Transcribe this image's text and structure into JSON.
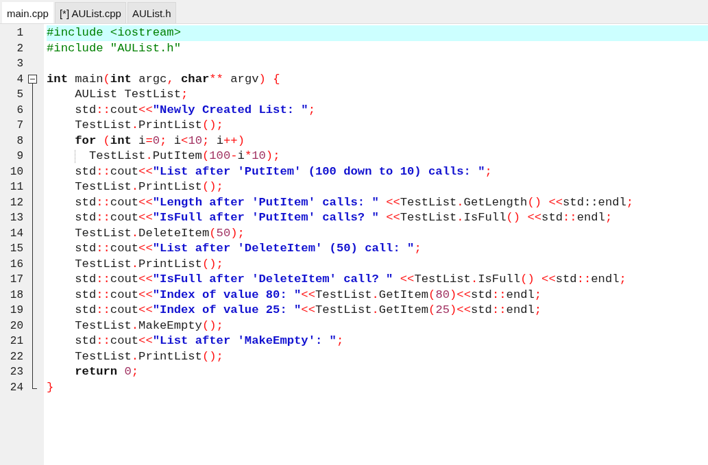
{
  "tabs": [
    {
      "label": "main.cpp",
      "selected": true
    },
    {
      "label": "[*] AUList.cpp",
      "selected": false
    },
    {
      "label": "AUList.h",
      "selected": false
    }
  ],
  "editor": {
    "lines": [
      {
        "number": "1",
        "current": true,
        "tokens": [
          {
            "kind": "pp",
            "text": "#include <iostream>"
          }
        ]
      },
      {
        "number": "2",
        "current": false,
        "tokens": [
          {
            "kind": "pp",
            "text": "#include \"AUList.h\""
          }
        ]
      },
      {
        "number": "3",
        "current": false
      },
      {
        "number": "4",
        "current": false,
        "fold": {
          "kind": "start"
        },
        "tokens": [
          {
            "kind": "kw",
            "text": "int"
          },
          {
            "kind": "plain",
            "text": " main"
          },
          {
            "kind": "op",
            "text": "("
          },
          {
            "kind": "kw",
            "text": "int"
          },
          {
            "kind": "plain",
            "text": " argc"
          },
          {
            "kind": "op",
            "text": ","
          },
          {
            "kind": "kw",
            "text": " char"
          },
          {
            "kind": "op",
            "text": "**"
          },
          {
            "kind": "plain",
            "text": " argv"
          },
          {
            "kind": "op",
            "text": ") {"
          }
        ]
      },
      {
        "number": "5",
        "current": false,
        "fold": {
          "kind": "line"
        },
        "tokens": [
          {
            "kind": "plain",
            "text": "    AUList TestList"
          },
          {
            "kind": "op",
            "text": ";"
          }
        ]
      },
      {
        "number": "6",
        "current": false,
        "fold": {
          "kind": "line"
        },
        "tokens": [
          {
            "kind": "plain",
            "text": "    std"
          },
          {
            "kind": "op",
            "text": "::"
          },
          {
            "kind": "plain",
            "text": "cout"
          },
          {
            "kind": "op",
            "text": "<<"
          },
          {
            "kind": "str",
            "text": "\"Newly Created List: \""
          },
          {
            "kind": "op",
            "text": ";"
          }
        ]
      },
      {
        "number": "7",
        "current": false,
        "fold": {
          "kind": "line"
        },
        "tokens": [
          {
            "kind": "plain",
            "text": "    TestList"
          },
          {
            "kind": "op",
            "text": "."
          },
          {
            "kind": "plain",
            "text": "PrintList"
          },
          {
            "kind": "op",
            "text": "();"
          }
        ]
      },
      {
        "number": "8",
        "current": false,
        "fold": {
          "kind": "line"
        },
        "tokens": [
          {
            "kind": "kw",
            "text": "    for"
          },
          {
            "kind": "op",
            "text": " ("
          },
          {
            "kind": "kw",
            "text": "int"
          },
          {
            "kind": "plain",
            "text": " i"
          },
          {
            "kind": "op",
            "text": "="
          },
          {
            "kind": "num",
            "text": "0"
          },
          {
            "kind": "op",
            "text": ";"
          },
          {
            "kind": "plain",
            "text": " i"
          },
          {
            "kind": "op",
            "text": "<"
          },
          {
            "kind": "num",
            "text": "10"
          },
          {
            "kind": "op",
            "text": ";"
          },
          {
            "kind": "plain",
            "text": " i"
          },
          {
            "kind": "op",
            "text": "++)"
          }
        ]
      },
      {
        "number": "9",
        "current": false,
        "fold": {
          "kind": "line"
        },
        "guide": true,
        "tokens": [
          {
            "kind": "plain",
            "text": "      TestList"
          },
          {
            "kind": "op",
            "text": "."
          },
          {
            "kind": "plain",
            "text": "PutItem"
          },
          {
            "kind": "op",
            "text": "("
          },
          {
            "kind": "num",
            "text": "100"
          },
          {
            "kind": "op",
            "text": "-"
          },
          {
            "kind": "plain",
            "text": "i"
          },
          {
            "kind": "op",
            "text": "*"
          },
          {
            "kind": "num",
            "text": "10"
          },
          {
            "kind": "op",
            "text": ");"
          }
        ]
      },
      {
        "number": "10",
        "current": false,
        "fold": {
          "kind": "line"
        },
        "tokens": [
          {
            "kind": "plain",
            "text": "    std"
          },
          {
            "kind": "op",
            "text": "::"
          },
          {
            "kind": "plain",
            "text": "cout"
          },
          {
            "kind": "op",
            "text": "<<"
          },
          {
            "kind": "str",
            "text": "\"List after 'PutItem' (100 down to 10) calls: \""
          },
          {
            "kind": "op",
            "text": ";"
          }
        ]
      },
      {
        "number": "11",
        "current": false,
        "fold": {
          "kind": "line"
        },
        "tokens": [
          {
            "kind": "plain",
            "text": "    TestList"
          },
          {
            "kind": "op",
            "text": "."
          },
          {
            "kind": "plain",
            "text": "PrintList"
          },
          {
            "kind": "op",
            "text": "();"
          }
        ]
      },
      {
        "number": "12",
        "current": false,
        "fold": {
          "kind": "line"
        },
        "tokens": [
          {
            "kind": "plain",
            "text": "    std"
          },
          {
            "kind": "op",
            "text": "::"
          },
          {
            "kind": "plain",
            "text": "cout"
          },
          {
            "kind": "op",
            "text": "<<"
          },
          {
            "kind": "str",
            "text": "\"Length after 'PutItem' calls: \""
          },
          {
            "kind": "op",
            "text": " <<"
          },
          {
            "kind": "plain",
            "text": "TestList"
          },
          {
            "kind": "op",
            "text": "."
          },
          {
            "kind": "plain",
            "text": "GetLength"
          },
          {
            "kind": "op",
            "text": "() <<"
          },
          {
            "kind": "plain",
            "text": "std::endl"
          },
          {
            "kind": "op",
            "text": ";"
          }
        ]
      },
      {
        "number": "13",
        "current": false,
        "fold": {
          "kind": "line"
        },
        "tokens": [
          {
            "kind": "plain",
            "text": "    std"
          },
          {
            "kind": "op",
            "text": "::"
          },
          {
            "kind": "plain",
            "text": "cout"
          },
          {
            "kind": "op",
            "text": "<<"
          },
          {
            "kind": "str",
            "text": "\"IsFull after 'PutItem' calls? \""
          },
          {
            "kind": "op",
            "text": " <<"
          },
          {
            "kind": "plain",
            "text": "TestList"
          },
          {
            "kind": "op",
            "text": "."
          },
          {
            "kind": "plain",
            "text": "IsFull"
          },
          {
            "kind": "op",
            "text": "() <<"
          },
          {
            "kind": "plain",
            "text": "std"
          },
          {
            "kind": "op",
            "text": "::"
          },
          {
            "kind": "plain",
            "text": "endl"
          },
          {
            "kind": "op",
            "text": ";"
          }
        ]
      },
      {
        "number": "14",
        "current": false,
        "fold": {
          "kind": "line"
        },
        "tokens": [
          {
            "kind": "plain",
            "text": "    TestList"
          },
          {
            "kind": "op",
            "text": "."
          },
          {
            "kind": "plain",
            "text": "DeleteItem"
          },
          {
            "kind": "op",
            "text": "("
          },
          {
            "kind": "num",
            "text": "50"
          },
          {
            "kind": "op",
            "text": ");"
          }
        ]
      },
      {
        "number": "15",
        "current": false,
        "fold": {
          "kind": "line"
        },
        "tokens": [
          {
            "kind": "plain",
            "text": "    std"
          },
          {
            "kind": "op",
            "text": "::"
          },
          {
            "kind": "plain",
            "text": "cout"
          },
          {
            "kind": "op",
            "text": "<<"
          },
          {
            "kind": "str",
            "text": "\"List after 'DeleteItem' (50) call: \""
          },
          {
            "kind": "op",
            "text": ";"
          }
        ]
      },
      {
        "number": "16",
        "current": false,
        "fold": {
          "kind": "line"
        },
        "tokens": [
          {
            "kind": "plain",
            "text": "    TestList"
          },
          {
            "kind": "op",
            "text": "."
          },
          {
            "kind": "plain",
            "text": "PrintList"
          },
          {
            "kind": "op",
            "text": "();"
          }
        ]
      },
      {
        "number": "17",
        "current": false,
        "fold": {
          "kind": "line"
        },
        "tokens": [
          {
            "kind": "plain",
            "text": "    std"
          },
          {
            "kind": "op",
            "text": "::"
          },
          {
            "kind": "plain",
            "text": "cout"
          },
          {
            "kind": "op",
            "text": "<<"
          },
          {
            "kind": "str",
            "text": "\"IsFull after 'DeleteItem' call? \""
          },
          {
            "kind": "op",
            "text": " <<"
          },
          {
            "kind": "plain",
            "text": "TestList"
          },
          {
            "kind": "op",
            "text": "."
          },
          {
            "kind": "plain",
            "text": "IsFull"
          },
          {
            "kind": "op",
            "text": "() <<"
          },
          {
            "kind": "plain",
            "text": "std"
          },
          {
            "kind": "op",
            "text": "::"
          },
          {
            "kind": "plain",
            "text": "endl"
          },
          {
            "kind": "op",
            "text": ";"
          }
        ]
      },
      {
        "number": "18",
        "current": false,
        "fold": {
          "kind": "line"
        },
        "tokens": [
          {
            "kind": "plain",
            "text": "    std"
          },
          {
            "kind": "op",
            "text": "::"
          },
          {
            "kind": "plain",
            "text": "cout"
          },
          {
            "kind": "op",
            "text": "<<"
          },
          {
            "kind": "str",
            "text": "\"Index of value 80: \""
          },
          {
            "kind": "op",
            "text": "<<"
          },
          {
            "kind": "plain",
            "text": "TestList"
          },
          {
            "kind": "op",
            "text": "."
          },
          {
            "kind": "plain",
            "text": "GetItem"
          },
          {
            "kind": "op",
            "text": "("
          },
          {
            "kind": "num",
            "text": "80"
          },
          {
            "kind": "op",
            "text": ")<<"
          },
          {
            "kind": "plain",
            "text": "std"
          },
          {
            "kind": "op",
            "text": "::"
          },
          {
            "kind": "plain",
            "text": "endl"
          },
          {
            "kind": "op",
            "text": ";"
          }
        ]
      },
      {
        "number": "19",
        "current": false,
        "fold": {
          "kind": "line"
        },
        "tokens": [
          {
            "kind": "plain",
            "text": "    std"
          },
          {
            "kind": "op",
            "text": "::"
          },
          {
            "kind": "plain",
            "text": "cout"
          },
          {
            "kind": "op",
            "text": "<<"
          },
          {
            "kind": "str",
            "text": "\"Index of value 25: \""
          },
          {
            "kind": "op",
            "text": "<<"
          },
          {
            "kind": "plain",
            "text": "TestList"
          },
          {
            "kind": "op",
            "text": "."
          },
          {
            "kind": "plain",
            "text": "GetItem"
          },
          {
            "kind": "op",
            "text": "("
          },
          {
            "kind": "num",
            "text": "25"
          },
          {
            "kind": "op",
            "text": ")<<"
          },
          {
            "kind": "plain",
            "text": "std"
          },
          {
            "kind": "op",
            "text": "::"
          },
          {
            "kind": "plain",
            "text": "endl"
          },
          {
            "kind": "op",
            "text": ";"
          }
        ]
      },
      {
        "number": "20",
        "current": false,
        "fold": {
          "kind": "line"
        },
        "tokens": [
          {
            "kind": "plain",
            "text": "    TestList"
          },
          {
            "kind": "op",
            "text": "."
          },
          {
            "kind": "plain",
            "text": "MakeEmpty"
          },
          {
            "kind": "op",
            "text": "();"
          }
        ]
      },
      {
        "number": "21",
        "current": false,
        "fold": {
          "kind": "line"
        },
        "tokens": [
          {
            "kind": "plain",
            "text": "    std"
          },
          {
            "kind": "op",
            "text": "::"
          },
          {
            "kind": "plain",
            "text": "cout"
          },
          {
            "kind": "op",
            "text": "<<"
          },
          {
            "kind": "str",
            "text": "\"List after 'MakeEmpty': \""
          },
          {
            "kind": "op",
            "text": ";"
          }
        ]
      },
      {
        "number": "22",
        "current": false,
        "fold": {
          "kind": "line"
        },
        "tokens": [
          {
            "kind": "plain",
            "text": "    TestList"
          },
          {
            "kind": "op",
            "text": "."
          },
          {
            "kind": "plain",
            "text": "PrintList"
          },
          {
            "kind": "op",
            "text": "();"
          }
        ]
      },
      {
        "number": "23",
        "current": false,
        "fold": {
          "kind": "line"
        },
        "tokens": [
          {
            "kind": "kw",
            "text": "    return"
          },
          {
            "kind": "num",
            "text": " 0"
          },
          {
            "kind": "op",
            "text": ";"
          }
        ]
      },
      {
        "number": "24",
        "current": false,
        "fold": {
          "kind": "end"
        },
        "tokens": [
          {
            "kind": "op",
            "text": "}"
          }
        ]
      }
    ]
  }
}
